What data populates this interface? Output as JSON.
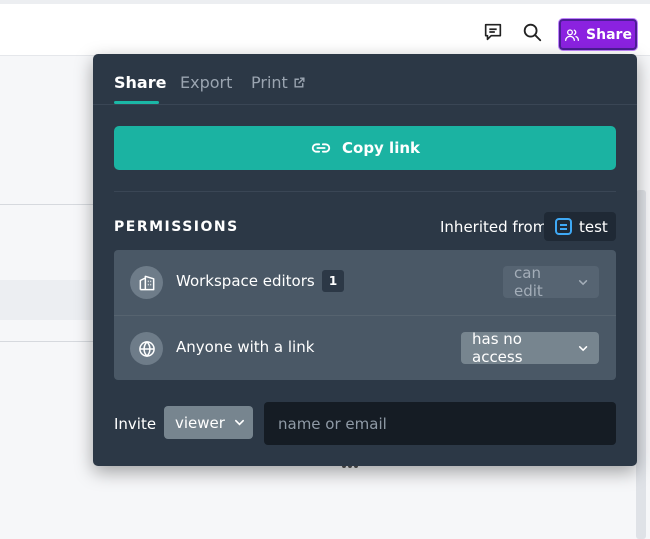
{
  "header": {
    "share_label": "Share",
    "icons": [
      "comments-icon",
      "search-icon",
      "people-icon"
    ],
    "accent": "#8b22e0"
  },
  "share_popover": {
    "tabs": [
      {
        "label": "Share",
        "active": true
      },
      {
        "label": "Export",
        "active": false
      },
      {
        "label": "Print",
        "active": false,
        "icon": "external-link-icon"
      }
    ],
    "copy_link_label": "Copy link",
    "copy_link_color": "#1bb3a2",
    "permissions": {
      "title": "PERMISSIONS",
      "inherited_label": "Inherited from",
      "inherited_doc": "test",
      "rows": [
        {
          "label": "Workspace editors",
          "count": "1",
          "access": "can edit",
          "icon": "building-icon",
          "disabled": true
        },
        {
          "label": "Anyone with a link",
          "access": "has no access",
          "icon": "globe-icon",
          "disabled": false
        }
      ]
    },
    "invite": {
      "label": "Invite",
      "role": "viewer",
      "placeholder": "name or email"
    }
  }
}
